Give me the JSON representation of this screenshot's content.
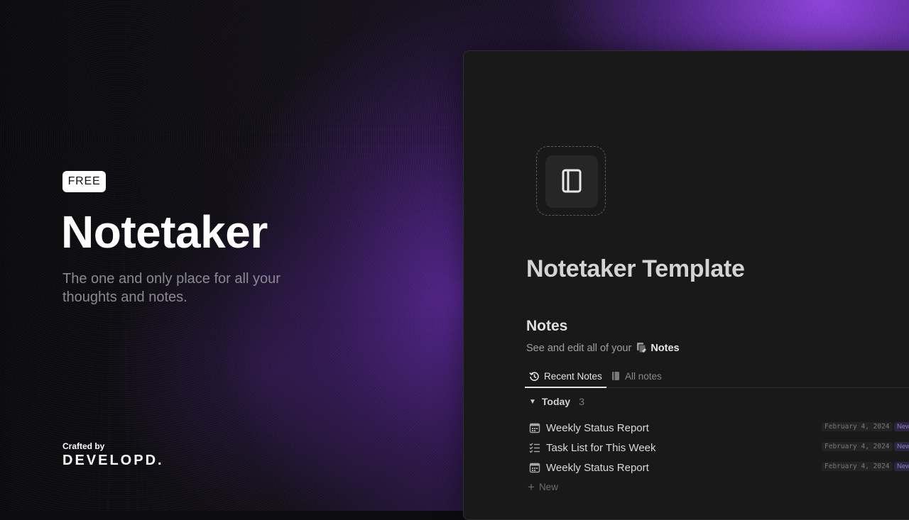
{
  "hero": {
    "badge": "FREE",
    "title": "Notetaker",
    "subtitle": "The one and only place for all your thoughts and notes.",
    "crafted_label": "Crafted by",
    "brand": "DEVELOPD."
  },
  "panel": {
    "page_icon": "notebook-icon",
    "page_title": "Notetaker Template",
    "section_title": "Notes",
    "description": "See and edit all of your",
    "description_link": "Notes",
    "tabs": [
      {
        "label": "Recent Notes",
        "icon": "history-icon",
        "active": true
      },
      {
        "label": "All notes",
        "icon": "notebook-icon",
        "active": false
      }
    ],
    "group": {
      "label": "Today",
      "count": "3"
    },
    "rows": [
      {
        "title": "Weekly Status Report",
        "icon": "calendar-icon",
        "date": "February 4, 2024",
        "tag": "New"
      },
      {
        "title": "Task List for This Week",
        "icon": "checklist-icon",
        "date": "February 4, 2024",
        "tag": "New"
      },
      {
        "title": "Weekly Status Report",
        "icon": "calendar-icon",
        "date": "February 4, 2024",
        "tag": "New"
      }
    ],
    "new_label": "New"
  },
  "colors": {
    "accent_purple": "#8a3fe0",
    "panel_bg": "#191919",
    "text_primary": "#ffffff",
    "text_muted": "#8a8a90"
  }
}
